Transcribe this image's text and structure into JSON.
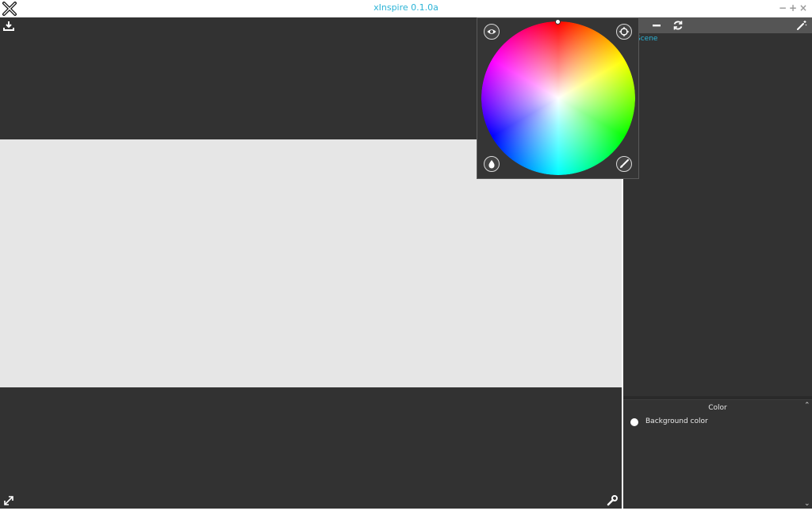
{
  "window": {
    "title": "xInspire 0.1.0a",
    "controls": {
      "minimize": "−",
      "maximize": "+",
      "close": "×"
    }
  },
  "viewport": {
    "icons": [
      "download-icon",
      "expand-icon",
      "wrench-icon"
    ],
    "background_color": "#323232",
    "canvas_color": "#e6e6e6"
  },
  "scene_panel": {
    "toolbar_icons": [
      "remove-icon",
      "refresh-icon",
      "magic-wand-icon"
    ],
    "tree": {
      "root_label": "Scene"
    }
  },
  "properties_panel": {
    "title": "Color",
    "background_color_label": "Background color",
    "background_color_value": "#ffffff"
  },
  "color_picker": {
    "buttons": [
      "eye-icon",
      "crosshair-icon",
      "droplet-icon",
      "brush-icon"
    ],
    "accent": "#2bb3d6"
  }
}
